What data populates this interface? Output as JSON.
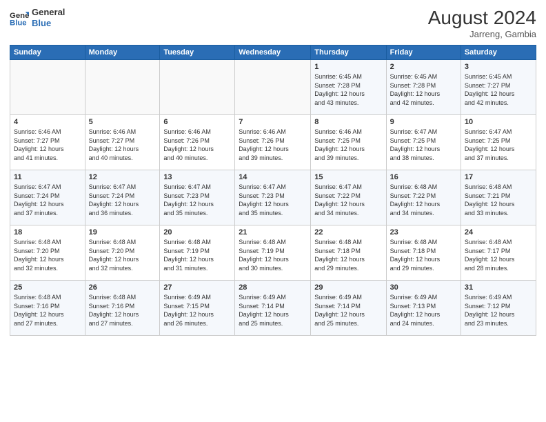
{
  "header": {
    "logo_line1": "General",
    "logo_line2": "Blue",
    "month_year": "August 2024",
    "location": "Jarreng, Gambia"
  },
  "days_of_week": [
    "Sunday",
    "Monday",
    "Tuesday",
    "Wednesday",
    "Thursday",
    "Friday",
    "Saturday"
  ],
  "weeks": [
    [
      {
        "day": "",
        "info": ""
      },
      {
        "day": "",
        "info": ""
      },
      {
        "day": "",
        "info": ""
      },
      {
        "day": "",
        "info": ""
      },
      {
        "day": "1",
        "info": "Sunrise: 6:45 AM\nSunset: 7:28 PM\nDaylight: 12 hours\nand 43 minutes."
      },
      {
        "day": "2",
        "info": "Sunrise: 6:45 AM\nSunset: 7:28 PM\nDaylight: 12 hours\nand 42 minutes."
      },
      {
        "day": "3",
        "info": "Sunrise: 6:45 AM\nSunset: 7:27 PM\nDaylight: 12 hours\nand 42 minutes."
      }
    ],
    [
      {
        "day": "4",
        "info": "Sunrise: 6:46 AM\nSunset: 7:27 PM\nDaylight: 12 hours\nand 41 minutes."
      },
      {
        "day": "5",
        "info": "Sunrise: 6:46 AM\nSunset: 7:27 PM\nDaylight: 12 hours\nand 40 minutes."
      },
      {
        "day": "6",
        "info": "Sunrise: 6:46 AM\nSunset: 7:26 PM\nDaylight: 12 hours\nand 40 minutes."
      },
      {
        "day": "7",
        "info": "Sunrise: 6:46 AM\nSunset: 7:26 PM\nDaylight: 12 hours\nand 39 minutes."
      },
      {
        "day": "8",
        "info": "Sunrise: 6:46 AM\nSunset: 7:25 PM\nDaylight: 12 hours\nand 39 minutes."
      },
      {
        "day": "9",
        "info": "Sunrise: 6:47 AM\nSunset: 7:25 PM\nDaylight: 12 hours\nand 38 minutes."
      },
      {
        "day": "10",
        "info": "Sunrise: 6:47 AM\nSunset: 7:25 PM\nDaylight: 12 hours\nand 37 minutes."
      }
    ],
    [
      {
        "day": "11",
        "info": "Sunrise: 6:47 AM\nSunset: 7:24 PM\nDaylight: 12 hours\nand 37 minutes."
      },
      {
        "day": "12",
        "info": "Sunrise: 6:47 AM\nSunset: 7:24 PM\nDaylight: 12 hours\nand 36 minutes."
      },
      {
        "day": "13",
        "info": "Sunrise: 6:47 AM\nSunset: 7:23 PM\nDaylight: 12 hours\nand 35 minutes."
      },
      {
        "day": "14",
        "info": "Sunrise: 6:47 AM\nSunset: 7:23 PM\nDaylight: 12 hours\nand 35 minutes."
      },
      {
        "day": "15",
        "info": "Sunrise: 6:47 AM\nSunset: 7:22 PM\nDaylight: 12 hours\nand 34 minutes."
      },
      {
        "day": "16",
        "info": "Sunrise: 6:48 AM\nSunset: 7:22 PM\nDaylight: 12 hours\nand 34 minutes."
      },
      {
        "day": "17",
        "info": "Sunrise: 6:48 AM\nSunset: 7:21 PM\nDaylight: 12 hours\nand 33 minutes."
      }
    ],
    [
      {
        "day": "18",
        "info": "Sunrise: 6:48 AM\nSunset: 7:20 PM\nDaylight: 12 hours\nand 32 minutes."
      },
      {
        "day": "19",
        "info": "Sunrise: 6:48 AM\nSunset: 7:20 PM\nDaylight: 12 hours\nand 32 minutes."
      },
      {
        "day": "20",
        "info": "Sunrise: 6:48 AM\nSunset: 7:19 PM\nDaylight: 12 hours\nand 31 minutes."
      },
      {
        "day": "21",
        "info": "Sunrise: 6:48 AM\nSunset: 7:19 PM\nDaylight: 12 hours\nand 30 minutes."
      },
      {
        "day": "22",
        "info": "Sunrise: 6:48 AM\nSunset: 7:18 PM\nDaylight: 12 hours\nand 29 minutes."
      },
      {
        "day": "23",
        "info": "Sunrise: 6:48 AM\nSunset: 7:18 PM\nDaylight: 12 hours\nand 29 minutes."
      },
      {
        "day": "24",
        "info": "Sunrise: 6:48 AM\nSunset: 7:17 PM\nDaylight: 12 hours\nand 28 minutes."
      }
    ],
    [
      {
        "day": "25",
        "info": "Sunrise: 6:48 AM\nSunset: 7:16 PM\nDaylight: 12 hours\nand 27 minutes."
      },
      {
        "day": "26",
        "info": "Sunrise: 6:48 AM\nSunset: 7:16 PM\nDaylight: 12 hours\nand 27 minutes."
      },
      {
        "day": "27",
        "info": "Sunrise: 6:49 AM\nSunset: 7:15 PM\nDaylight: 12 hours\nand 26 minutes."
      },
      {
        "day": "28",
        "info": "Sunrise: 6:49 AM\nSunset: 7:14 PM\nDaylight: 12 hours\nand 25 minutes."
      },
      {
        "day": "29",
        "info": "Sunrise: 6:49 AM\nSunset: 7:14 PM\nDaylight: 12 hours\nand 25 minutes."
      },
      {
        "day": "30",
        "info": "Sunrise: 6:49 AM\nSunset: 7:13 PM\nDaylight: 12 hours\nand 24 minutes."
      },
      {
        "day": "31",
        "info": "Sunrise: 6:49 AM\nSunset: 7:12 PM\nDaylight: 12 hours\nand 23 minutes."
      }
    ]
  ]
}
